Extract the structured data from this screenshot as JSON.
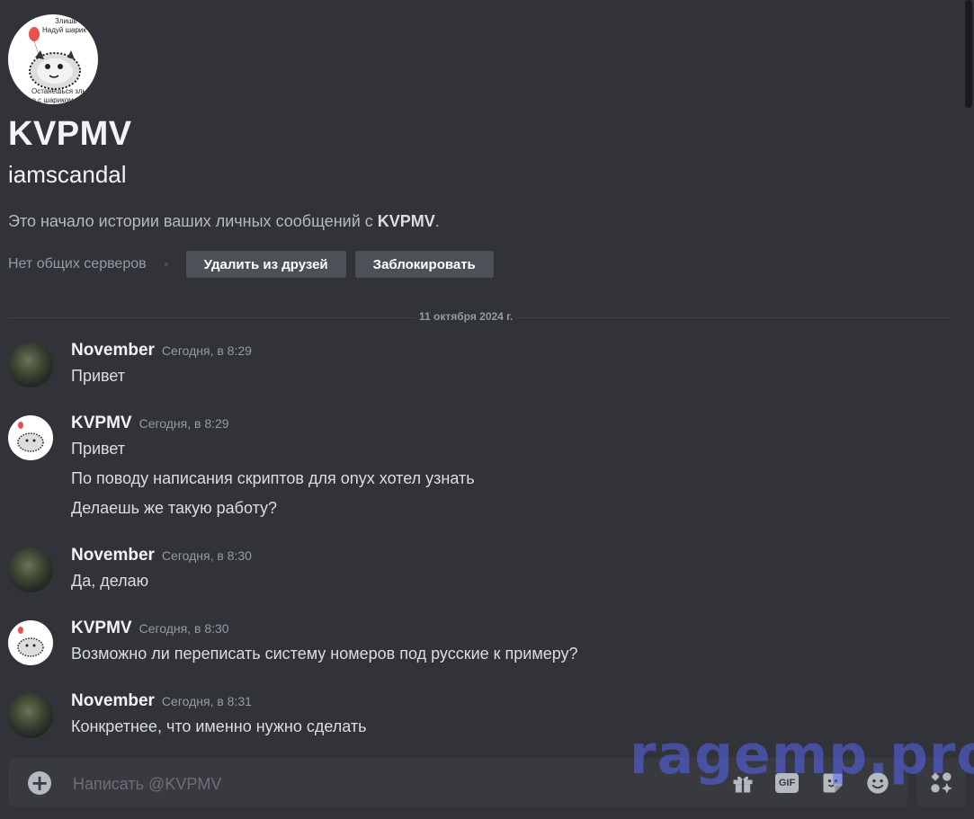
{
  "profile": {
    "display_name": "KVPMV",
    "username": "iamscandal",
    "avatar_text_top": "Злишь",
    "avatar_text_mid": "Надуй шарик",
    "avatar_text_bottom": "Останешься злым,",
    "avatar_text_bottom2": "но с шариком",
    "intro_prefix": "Это начало истории ваших личных сообщений с ",
    "intro_name": "KVPMV",
    "intro_suffix": ".",
    "mutual_servers": "Нет общих серверов",
    "remove_friend_label": "Удалить из друзей",
    "block_label": "Заблокировать"
  },
  "date_divider": "11 октября 2024 г.",
  "messages": [
    {
      "author": "November",
      "time": "Сегодня, в 8:29",
      "lines": [
        "Привет"
      ]
    },
    {
      "author": "KVPMV",
      "time": "Сегодня, в 8:29",
      "lines": [
        "Привет",
        "По поводу написания скриптов для onyx хотел узнать",
        "Делаешь же такую работу?"
      ]
    },
    {
      "author": "November",
      "time": "Сегодня, в 8:30",
      "lines": [
        "Да, делаю"
      ]
    },
    {
      "author": "KVPMV",
      "time": "Сегодня, в 8:30",
      "lines": [
        "Возможно ли переписать систему номеров под русские к примеру?"
      ]
    },
    {
      "author": "November",
      "time": "Сегодня, в 8:31",
      "lines": [
        "Конкретнее, что именно нужно сделать"
      ]
    }
  ],
  "composer": {
    "placeholder": "Написать @KVPMV",
    "gif_label": "GIF"
  },
  "icons": [
    "plus-icon",
    "gift-icon",
    "gif-icon",
    "sticker-icon",
    "emoji-icon",
    "apps-icon"
  ],
  "watermark": "ragemp.pro"
}
